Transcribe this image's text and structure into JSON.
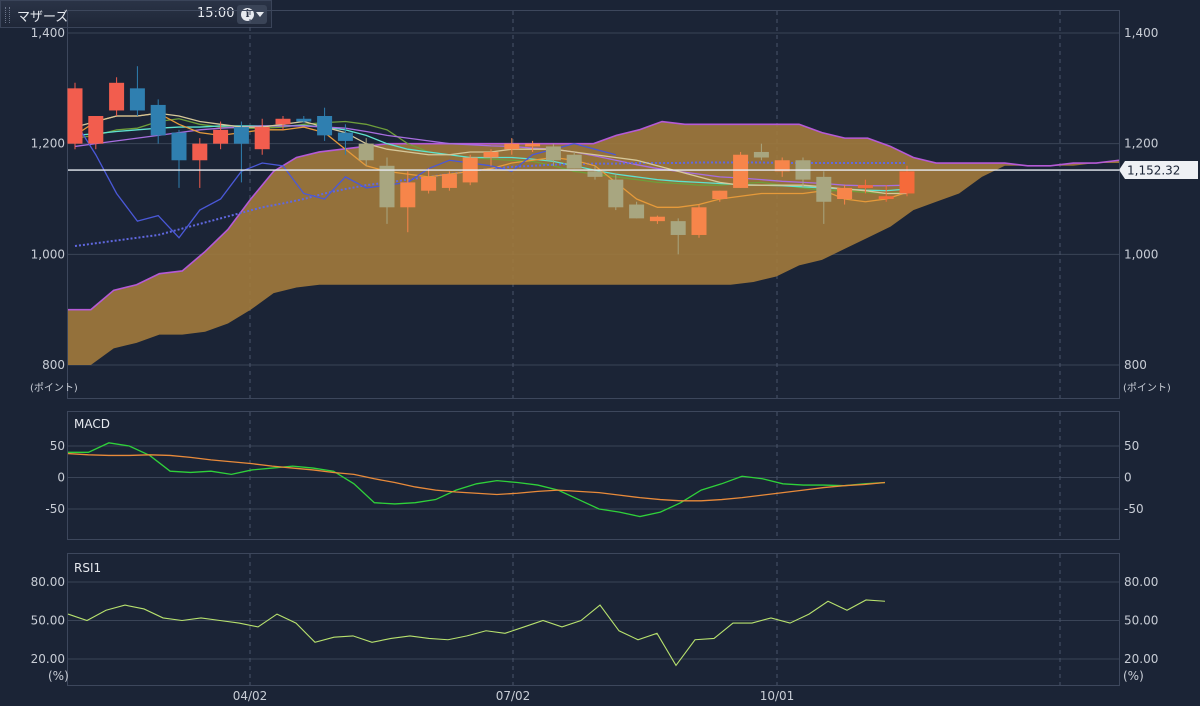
{
  "header": {
    "symbol": "マザーズ",
    "time": "15:00",
    "info_icon": "info-icon",
    "menu_icon": "caret-down-icon"
  },
  "chart_data": [
    {
      "type": "candlestick",
      "title": "",
      "ylim": [
        800,
        1400
      ],
      "yticks": [
        "1,400",
        "1,200",
        "1,000",
        "800"
      ],
      "yunit": "(ポイント)",
      "xticks": [
        "04/02",
        "07/02",
        "10/01"
      ],
      "last_price_label": "1,152.32",
      "last_price": 1152.32,
      "candles": [
        {
          "o": 1200,
          "h": 1310,
          "l": 1190,
          "c": 1300
        },
        {
          "o": 1200,
          "h": 1250,
          "l": 1190,
          "c": 1250
        },
        {
          "o": 1260,
          "h": 1320,
          "l": 1250,
          "c": 1310
        },
        {
          "o": 1300,
          "h": 1340,
          "l": 1250,
          "c": 1260
        },
        {
          "o": 1270,
          "h": 1280,
          "l": 1200,
          "c": 1215
        },
        {
          "o": 1220,
          "h": 1225,
          "l": 1120,
          "c": 1170
        },
        {
          "o": 1170,
          "h": 1210,
          "l": 1120,
          "c": 1200
        },
        {
          "o": 1200,
          "h": 1240,
          "l": 1190,
          "c": 1225
        },
        {
          "o": 1230,
          "h": 1240,
          "l": 1130,
          "c": 1200
        },
        {
          "o": 1190,
          "h": 1245,
          "l": 1180,
          "c": 1230
        },
        {
          "o": 1235,
          "h": 1250,
          "l": 1225,
          "c": 1245
        },
        {
          "o": 1245,
          "h": 1250,
          "l": 1238,
          "c": 1240
        },
        {
          "o": 1250,
          "h": 1265,
          "l": 1205,
          "c": 1215
        },
        {
          "o": 1220,
          "h": 1235,
          "l": 1180,
          "c": 1205
        },
        {
          "o": 1200,
          "h": 1210,
          "l": 1160,
          "c": 1170
        },
        {
          "o": 1160,
          "h": 1175,
          "l": 1055,
          "c": 1085
        },
        {
          "o": 1085,
          "h": 1150,
          "l": 1040,
          "c": 1130
        },
        {
          "o": 1115,
          "h": 1155,
          "l": 1110,
          "c": 1140
        },
        {
          "o": 1120,
          "h": 1150,
          "l": 1115,
          "c": 1145
        },
        {
          "o": 1130,
          "h": 1180,
          "l": 1125,
          "c": 1175
        },
        {
          "o": 1175,
          "h": 1190,
          "l": 1160,
          "c": 1185
        },
        {
          "o": 1190,
          "h": 1210,
          "l": 1180,
          "c": 1200
        },
        {
          "o": 1195,
          "h": 1205,
          "l": 1185,
          "c": 1200
        },
        {
          "o": 1195,
          "h": 1200,
          "l": 1160,
          "c": 1170
        },
        {
          "o": 1180,
          "h": 1185,
          "l": 1155,
          "c": 1155
        },
        {
          "o": 1150,
          "h": 1160,
          "l": 1135,
          "c": 1140
        },
        {
          "o": 1135,
          "h": 1145,
          "l": 1080,
          "c": 1085
        },
        {
          "o": 1090,
          "h": 1095,
          "l": 1065,
          "c": 1065
        },
        {
          "o": 1060,
          "h": 1070,
          "l": 1055,
          "c": 1068
        },
        {
          "o": 1060,
          "h": 1065,
          "l": 1000,
          "c": 1035
        },
        {
          "o": 1035,
          "h": 1090,
          "l": 1030,
          "c": 1085
        },
        {
          "o": 1100,
          "h": 1115,
          "l": 1095,
          "c": 1115
        },
        {
          "o": 1120,
          "h": 1185,
          "l": 1120,
          "c": 1180
        },
        {
          "o": 1185,
          "h": 1200,
          "l": 1170,
          "c": 1175
        },
        {
          "o": 1150,
          "h": 1175,
          "l": 1140,
          "c": 1170
        },
        {
          "o": 1170,
          "h": 1175,
          "l": 1120,
          "c": 1135
        },
        {
          "o": 1140,
          "h": 1150,
          "l": 1055,
          "c": 1095
        },
        {
          "o": 1100,
          "h": 1125,
          "l": 1090,
          "c": 1120
        },
        {
          "o": 1120,
          "h": 1135,
          "l": 1110,
          "c": 1125
        },
        {
          "o": 1100,
          "h": 1125,
          "l": 1095,
          "c": 1105
        },
        {
          "o": 1110,
          "h": 1160,
          "l": 1105,
          "c": 1150
        }
      ],
      "cloud": {
        "upper": [
          900,
          900,
          935,
          945,
          965,
          970,
          1005,
          1045,
          1100,
          1150,
          1175,
          1185,
          1190,
          1195,
          1200,
          1200,
          1200,
          1200,
          1200,
          1200,
          1200,
          1200,
          1200,
          1200,
          1215,
          1225,
          1240,
          1235,
          1235,
          1235,
          1235,
          1235,
          1235,
          1220,
          1210,
          1210,
          1195,
          1175,
          1165,
          1165,
          1165,
          1165,
          1160,
          1160,
          1165,
          1165,
          1170
        ],
        "lower": [
          800,
          800,
          830,
          840,
          855,
          855,
          860,
          875,
          900,
          930,
          940,
          945,
          945,
          945,
          945,
          945,
          945,
          945,
          945,
          945,
          945,
          945,
          945,
          945,
          945,
          945,
          945,
          945,
          945,
          945,
          950,
          960,
          980,
          990,
          1010,
          1030,
          1050,
          1080,
          1095,
          1110,
          1140,
          1160,
          1160,
          1160,
          1160,
          1165,
          1165
        ]
      },
      "lines": [
        {
          "name": "ma_short",
          "color": "#6e9e3a",
          "values": [
            1210,
            1215,
            1225,
            1228,
            1240,
            1245,
            1235,
            1230,
            1228,
            1228,
            1230,
            1235,
            1238,
            1240,
            1235,
            1225,
            1200,
            1185,
            1180,
            1175,
            1172,
            1170,
            1168,
            1160,
            1150,
            1145,
            1140,
            1135,
            1130,
            1128,
            1125,
            1125,
            1128,
            1130,
            1125,
            1120,
            1115,
            1115,
            1112,
            1110,
            1112
          ]
        },
        {
          "name": "ma_mid",
          "color": "#5fe2cf",
          "values": [
            1215,
            1218,
            1222,
            1225,
            1228,
            1230,
            1230,
            1232,
            1232,
            1232,
            1232,
            1233,
            1230,
            1225,
            1215,
            1200,
            1190,
            1185,
            1180,
            1175,
            1175,
            1175,
            1172,
            1168,
            1160,
            1152,
            1145,
            1140,
            1135,
            1132,
            1130,
            1128,
            1126,
            1125,
            1124,
            1122,
            1120,
            1118,
            1116,
            1115,
            1118
          ]
        },
        {
          "name": "ma_long",
          "color": "#a86ee0",
          "values": [
            1195,
            1200,
            1205,
            1210,
            1215,
            1220,
            1225,
            1228,
            1230,
            1232,
            1232,
            1232,
            1230,
            1228,
            1222,
            1215,
            1210,
            1205,
            1200,
            1198,
            1196,
            1195,
            1192,
            1190,
            1185,
            1178,
            1170,
            1162,
            1155,
            1150,
            1145,
            1140,
            1138,
            1135,
            1132,
            1130,
            1128,
            1125,
            1124,
            1124,
            1125
          ]
        },
        {
          "name": "ma_200",
          "color": "#6068e0",
          "dashed": true,
          "values": [
            1015,
            1020,
            1025,
            1030,
            1035,
            1045,
            1055,
            1065,
            1075,
            1085,
            1092,
            1100,
            1110,
            1118,
            1125,
            1130,
            1135,
            1140,
            1145,
            1150,
            1155,
            1158,
            1160,
            1162,
            1163,
            1164,
            1164,
            1165,
            1165,
            1165,
            1166,
            1166,
            1166,
            1166,
            1165,
            1165,
            1165,
            1165,
            1165,
            1165,
            1165
          ]
        },
        {
          "name": "tenkan",
          "color": "#e69a3a",
          "values": [
            1215,
            1240,
            1250,
            1250,
            1255,
            1235,
            1220,
            1215,
            1220,
            1225,
            1225,
            1230,
            1220,
            1190,
            1160,
            1150,
            1145,
            1140,
            1145,
            1150,
            1155,
            1165,
            1170,
            1175,
            1170,
            1160,
            1130,
            1100,
            1085,
            1085,
            1090,
            1100,
            1105,
            1110,
            1110,
            1110,
            1115,
            1100,
            1095,
            1100,
            1112
          ]
        },
        {
          "name": "kijun",
          "color": "#d6c89a",
          "values": [
            1230,
            1240,
            1250,
            1250,
            1255,
            1250,
            1240,
            1235,
            1230,
            1230,
            1235,
            1240,
            1230,
            1220,
            1200,
            1190,
            1185,
            1180,
            1180,
            1185,
            1185,
            1190,
            1190,
            1190,
            1185,
            1180,
            1175,
            1170,
            1160,
            1150,
            1140,
            1130,
            1125,
            1125,
            1125,
            1125,
            1122,
            1118,
            1115,
            1110,
            1110
          ]
        },
        {
          "name": "chikou",
          "color": "#4a58d8",
          "values": [
            1240,
            1180,
            1110,
            1060,
            1070,
            1030,
            1080,
            1100,
            1150,
            1165,
            1160,
            1110,
            1100,
            1140,
            1120,
            1125,
            1130,
            1155,
            1170,
            1165,
            1160,
            1150,
            1180,
            1190,
            1200,
            1190,
            1180
          ]
        }
      ]
    },
    {
      "type": "line",
      "title": "MACD",
      "ylim": [
        -75,
        75
      ],
      "yticks": [
        "50",
        "0",
        "-50"
      ],
      "series": [
        {
          "name": "MACD",
          "color": "#2fd13a",
          "values": [
            40,
            40,
            55,
            50,
            35,
            10,
            8,
            10,
            5,
            12,
            15,
            18,
            15,
            10,
            -10,
            -40,
            -42,
            -40,
            -35,
            -20,
            -10,
            -5,
            -8,
            -12,
            -20,
            -35,
            -50,
            -55,
            -62,
            -55,
            -40,
            -20,
            -10,
            2,
            -2,
            -10,
            -12,
            -12,
            -13,
            -10,
            -8
          ]
        },
        {
          "name": "Signal",
          "color": "#e88a3a",
          "values": [
            38,
            36,
            35,
            35,
            36,
            35,
            32,
            28,
            25,
            22,
            18,
            15,
            12,
            8,
            5,
            -2,
            -8,
            -15,
            -20,
            -23,
            -25,
            -27,
            -25,
            -22,
            -20,
            -22,
            -24,
            -28,
            -32,
            -35,
            -37,
            -37,
            -35,
            -32,
            -28,
            -24,
            -20,
            -16,
            -13,
            -11,
            -8
          ]
        }
      ]
    },
    {
      "type": "line",
      "title": "RSI1",
      "ylim": [
        0,
        100
      ],
      "yticks": [
        "80.00",
        "50.00",
        "20.00"
      ],
      "yunit": "(%)",
      "series": [
        {
          "name": "RSI",
          "color": "#b8e26e",
          "values": [
            55,
            50,
            58,
            62,
            59,
            52,
            50,
            52,
            50,
            48,
            45,
            55,
            48,
            33,
            37,
            38,
            33,
            36,
            38,
            36,
            35,
            38,
            42,
            40,
            45,
            50,
            45,
            50,
            62,
            42,
            35,
            40,
            15,
            35,
            36,
            48,
            48,
            52,
            48,
            55,
            65,
            58,
            66,
            65
          ]
        }
      ]
    }
  ]
}
